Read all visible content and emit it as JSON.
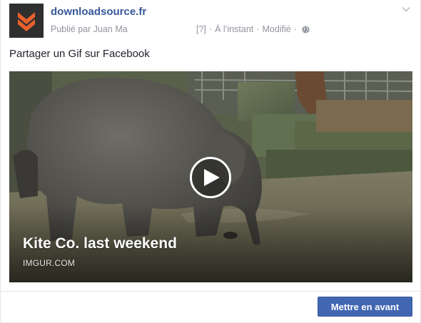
{
  "post": {
    "page_name": "downloadsource.fr",
    "published_by": "Publié par Juan Ma",
    "help_marker": "[?]",
    "time": "À l’instant",
    "separator": "·",
    "edited": "Modifié",
    "audience_icon": "globe-icon",
    "menu_icon": "chevron-down-icon",
    "text": "Partager un Gif sur Facebook"
  },
  "media": {
    "title": "Kite Co. last weekend",
    "source": "IMGUR.COM",
    "play_icon": "play-icon"
  },
  "actions": {
    "boost_label": "Mettre en avant"
  },
  "colors": {
    "page_name": "#365899",
    "meta_text": "#90949c",
    "button_bg": "#4267b2",
    "avatar_bg": "#2f2f2f",
    "avatar_accent": "#e8612c"
  }
}
